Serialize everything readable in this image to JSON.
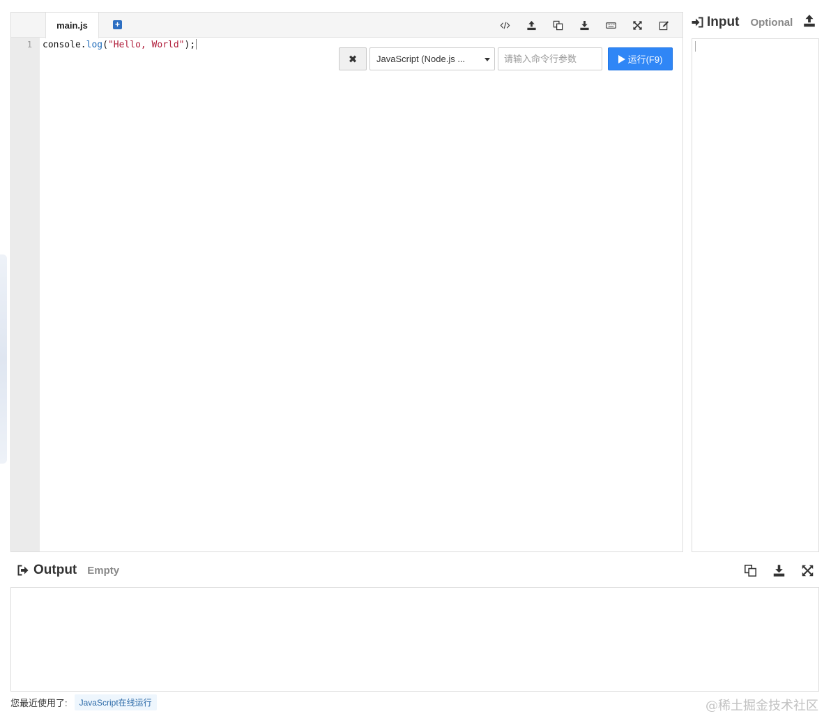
{
  "editor": {
    "tab_label": "main.js",
    "add_tab_symbol": "+",
    "toolbar_icons": [
      "code-icon",
      "upload-icon",
      "copy-icon",
      "download-icon",
      "keyboard-icon",
      "expand-icon",
      "edit-icon"
    ],
    "line_number": "1",
    "code": {
      "obj": "console.",
      "fn": "log",
      "open": "(",
      "str": "\"Hello, World\"",
      "close": ");"
    },
    "clear_symbol": "✖",
    "language_selected": "JavaScript (Node.js ...",
    "args_placeholder": "请输入命令行参数",
    "run_label": "运行(F9)"
  },
  "input_panel": {
    "title": "Input",
    "subtitle": "Optional"
  },
  "output_panel": {
    "title": "Output",
    "status": "Empty"
  },
  "footer": {
    "recent_label": "您最近使用了:",
    "recent_item": "JavaScript在线运行",
    "watermark": "@稀土掘金技术社区"
  },
  "colors": {
    "run_button": "#2f86f6",
    "gutter": "#ebebeb",
    "string": "#b01d3a",
    "function": "#1d6ab9"
  }
}
